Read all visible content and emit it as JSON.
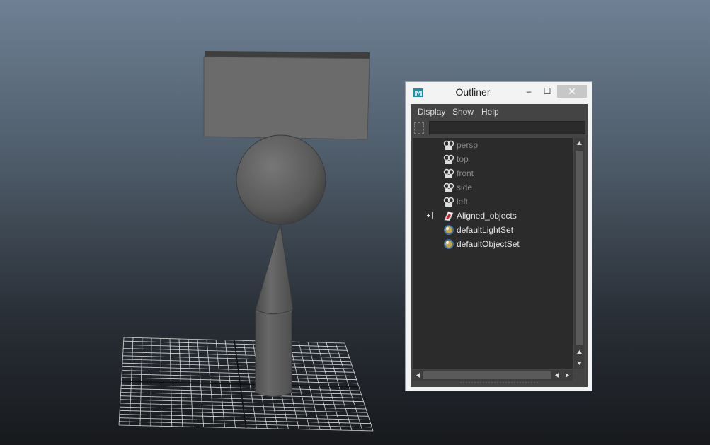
{
  "outliner": {
    "title": "Outliner",
    "buttons": {
      "minimize": "–",
      "maximize": "☐",
      "close": "✕"
    },
    "menu": [
      "Display",
      "Show",
      "Help"
    ],
    "filter_value": "",
    "items": [
      {
        "label": "persp",
        "icon": "camera-icon",
        "visible": false,
        "expandable": false
      },
      {
        "label": "top",
        "icon": "camera-icon",
        "visible": false,
        "expandable": false
      },
      {
        "label": "front",
        "icon": "camera-icon",
        "visible": false,
        "expandable": false
      },
      {
        "label": "side",
        "icon": "camera-icon",
        "visible": false,
        "expandable": false
      },
      {
        "label": "left",
        "icon": "camera-icon",
        "visible": false,
        "expandable": false
      },
      {
        "label": "Aligned_objects",
        "icon": "group-icon",
        "visible": true,
        "expandable": true
      },
      {
        "label": "defaultLightSet",
        "icon": "set-icon",
        "visible": true,
        "expandable": false
      },
      {
        "label": "defaultObjectSet",
        "icon": "set-icon",
        "visible": true,
        "expandable": false
      }
    ]
  },
  "colors": {
    "viewport_top": "#6e8094",
    "viewport_bottom": "#17191c",
    "object_gray": "#6a6a6a",
    "grid_line": "#d8d8d8",
    "panel_bg": "#444444",
    "list_bg": "#2b2b2b"
  }
}
